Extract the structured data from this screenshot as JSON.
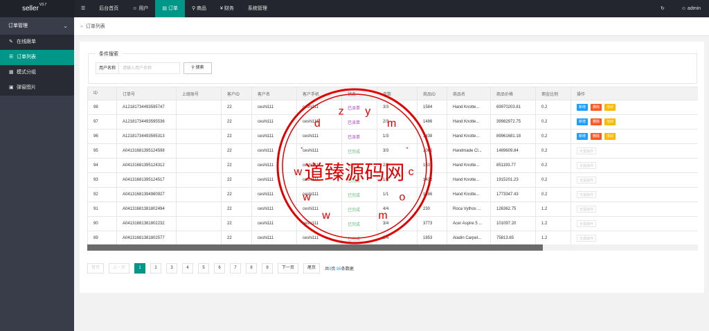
{
  "app": {
    "logo": "seller",
    "version": "V3.7"
  },
  "topnav": {
    "menu_icon": "hamburger-icon",
    "items": [
      {
        "label": "后台首页",
        "icon": ""
      },
      {
        "label": "用户",
        "icon": "user-icon"
      },
      {
        "label": "订单",
        "icon": "document-icon"
      },
      {
        "label": "商品",
        "icon": "cart-icon"
      },
      {
        "label": "财务",
        "icon": "yen-icon"
      },
      {
        "label": "系统管理",
        "icon": ""
      }
    ],
    "active": "订单",
    "refresh_icon": "refresh-icon",
    "user": "admin"
  },
  "sidebar": {
    "group": "订单管理",
    "items": [
      {
        "label": "在线跟单",
        "icon": "edit-icon"
      },
      {
        "label": "订单列表",
        "icon": "list-icon"
      },
      {
        "label": "模式分组",
        "icon": "group-icon"
      },
      {
        "label": "弹窗图片",
        "icon": "image-icon"
      }
    ],
    "active": "订单列表"
  },
  "breadcrumb": {
    "current": "订单列表"
  },
  "search": {
    "legend": "条件搜索",
    "label": "用户名称",
    "placeholder": "请输入用户名称",
    "button": "搜索"
  },
  "table": {
    "columns": [
      "ID",
      "订单号",
      "上级账号",
      "客户ID",
      "客户名",
      "客户手机",
      "状态",
      "单数",
      "商品ID",
      "商品名",
      "商品价格",
      "佣金比例",
      "操作"
    ],
    "rows": [
      {
        "id": "98",
        "order_no": "A12181734493595747",
        "parent": "",
        "cust_id": "22",
        "cust_name": "ceshi111",
        "phone": "ceshi111",
        "status": "已派单",
        "count": "3/3",
        "goods_id": "1584",
        "goods_name": "Hand Knotte...",
        "price": "69970203.81",
        "rate": "0.2",
        "ops": "full"
      },
      {
        "id": "97",
        "order_no": "A12181734493595536",
        "parent": "",
        "cust_id": "22",
        "cust_name": "ceshi111",
        "phone": "ceshi111",
        "status": "已派单",
        "count": "2/3",
        "goods_id": "1486",
        "goods_name": "Hand Knotte...",
        "price": "39982972.75",
        "rate": "0.2",
        "ops": "full"
      },
      {
        "id": "96",
        "order_no": "A12181734493595313",
        "parent": "",
        "cust_id": "22",
        "cust_name": "ceshi111",
        "phone": "ceshi111",
        "status": "已派单",
        "count": "1/3",
        "goods_id": "1438",
        "goods_name": "Hand Knotte...",
        "price": "89961681.18",
        "rate": "0.2",
        "ops": "full"
      },
      {
        "id": "95",
        "order_no": "A04131681395124598",
        "parent": "",
        "cust_id": "22",
        "cust_name": "ceshi111",
        "phone": "ceshi111",
        "status": "已完成",
        "count": "3/3",
        "goods_id": "1062",
        "goods_name": "Handmade Cl...",
        "price": "1489609.84",
        "rate": "0.2",
        "ops": "none"
      },
      {
        "id": "94",
        "order_no": "A04131681395124312",
        "parent": "",
        "cust_id": "22",
        "cust_name": "ceshi111",
        "phone": "ceshi111",
        "status": "已完成",
        "count": "2/3",
        "goods_id": "1531",
        "goods_name": "Hand Knotte...",
        "price": "851193.77",
        "rate": "0.2",
        "ops": "none"
      },
      {
        "id": "93",
        "order_no": "A04131681395124517",
        "parent": "",
        "cust_id": "22",
        "cust_name": "ceshi111",
        "phone": "ceshi111",
        "status": "已完成",
        "count": "1/3",
        "goods_id": "1432",
        "goods_name": "Hand Knotte...",
        "price": "1915201.23",
        "rate": "0.2",
        "ops": "none"
      },
      {
        "id": "92",
        "order_no": "A04131681394980927",
        "parent": "",
        "cust_id": "22",
        "cust_name": "ceshi111",
        "phone": "ceshi111",
        "status": "已完成",
        "count": "1/1",
        "goods_id": "1486",
        "goods_name": "Hand Knotte...",
        "price": "1773347.43",
        "rate": "0.2",
        "ops": "none"
      },
      {
        "id": "91",
        "order_no": "A04131681381802494",
        "parent": "",
        "cust_id": "22",
        "cust_name": "ceshi111",
        "phone": "ceshi111",
        "status": "已完成",
        "count": "4/4",
        "goods_id": "230",
        "goods_name": "Roca Vythos ...",
        "price": "126362.75",
        "rate": "1.2",
        "ops": "none"
      },
      {
        "id": "90",
        "order_no": "A04131681381802232",
        "parent": "",
        "cust_id": "22",
        "cust_name": "ceshi111",
        "phone": "ceshi111",
        "status": "已完成",
        "count": "3/4",
        "goods_id": "3773",
        "goods_name": "Acer Aspire 5 ...",
        "price": "101097.20",
        "rate": "1.2",
        "ops": "none"
      },
      {
        "id": "89",
        "order_no": "A04131681381802577",
        "parent": "",
        "cust_id": "22",
        "cust_name": "ceshi111",
        "phone": "ceshi111",
        "status": "已完成",
        "count": "2/4",
        "goods_id": "1853",
        "goods_name": "Aladin Carpet...",
        "price": "75813.65",
        "rate": "1.2",
        "ops": "none"
      }
    ],
    "op_labels": {
      "new": "新增",
      "del": "删除",
      "act": "活动",
      "none": "无需操作"
    }
  },
  "pagination": {
    "first": "首页",
    "prev": "上一页",
    "pages": [
      "1",
      "2",
      "3",
      "4",
      "5",
      "6",
      "7",
      "8",
      "9"
    ],
    "current": "1",
    "next": "下一页",
    "last": "尾页",
    "total_pages": "9",
    "total_records": "86",
    "info_prefix": "共",
    "info_pages_suffix": "页",
    "info_records_suffix": "条数据"
  },
  "watermark": {
    "text": "道臻源码网",
    "url": "www.dzym.com"
  },
  "colors": {
    "primary": "#009688",
    "sidebar": "#393d49",
    "topbar": "#23262e",
    "blue": "#1e9fff",
    "red": "#ff5722",
    "orange": "#ffb800",
    "green": "#5FB878",
    "purple": "#a233c6",
    "stamp": "#e00000"
  }
}
